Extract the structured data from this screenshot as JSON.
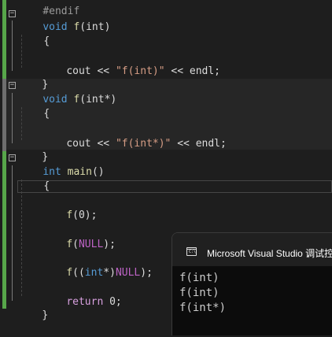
{
  "editor": {
    "preprocessor_line": "#endif",
    "func_int": {
      "sig_kw": "void",
      "sig_name": "f",
      "sig_params": "(int)",
      "open_brace": "{",
      "body_cout": "cout <<",
      "body_str": "\"f(int)\"",
      "body_tail": "<< endl;",
      "close_brace": "}"
    },
    "func_intptr": {
      "sig_kw": "void",
      "sig_name": "f",
      "sig_params": "(int*)",
      "open_brace": "{",
      "body_cout": "cout <<",
      "body_str": "\"f(int*)\"",
      "body_tail": "<< endl;",
      "close_brace": "}"
    },
    "main": {
      "sig_kw": "int",
      "sig_name": "main",
      "sig_params": "()",
      "open_brace": "{",
      "call1_name": "f",
      "call1_args": "(0);",
      "call2_name": "f",
      "call2_open": "(",
      "call2_macro": "NULL",
      "call2_close": ");",
      "call3_name": "f",
      "call3_open": "((",
      "call3_kw": "int",
      "call3_mid": "*)",
      "call3_macro": "NULL",
      "call3_close": ");",
      "return_kw": "return",
      "return_val": "0;",
      "close_brace": "}"
    },
    "fold_symbol": "−",
    "colors": {
      "background": "#1e1e1e",
      "keyword": "#569cd6",
      "function": "#dcdcaa",
      "string": "#d69d85",
      "macro": "#bd63c5",
      "change_bar": "#57a64a"
    }
  },
  "console": {
    "title": "Microsoft Visual Studio 调试控制台",
    "icon": "console-app-icon",
    "icon_glyph": "C:\\",
    "output": [
      "f(int)",
      "f(int)",
      "f(int*)"
    ]
  }
}
